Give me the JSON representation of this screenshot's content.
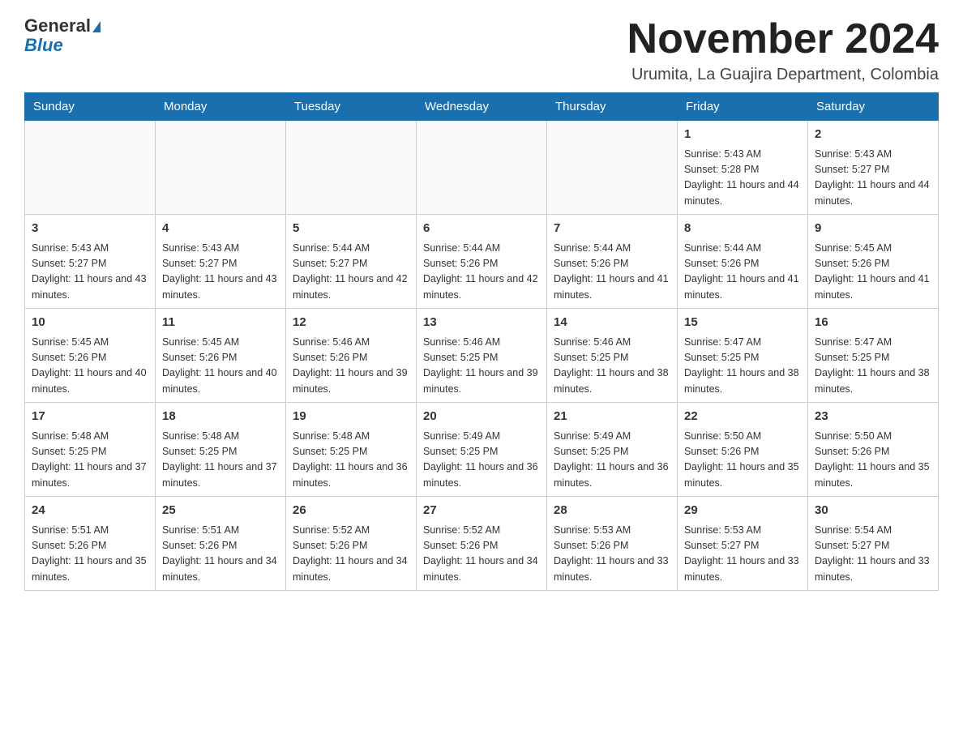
{
  "header": {
    "logo_line1": "General",
    "logo_line2": "Blue",
    "title": "November 2024",
    "subtitle": "Urumita, La Guajira Department, Colombia"
  },
  "days_of_week": [
    "Sunday",
    "Monday",
    "Tuesday",
    "Wednesday",
    "Thursday",
    "Friday",
    "Saturday"
  ],
  "weeks": [
    [
      {
        "day": "",
        "info": ""
      },
      {
        "day": "",
        "info": ""
      },
      {
        "day": "",
        "info": ""
      },
      {
        "day": "",
        "info": ""
      },
      {
        "day": "",
        "info": ""
      },
      {
        "day": "1",
        "info": "Sunrise: 5:43 AM\nSunset: 5:28 PM\nDaylight: 11 hours and 44 minutes."
      },
      {
        "day": "2",
        "info": "Sunrise: 5:43 AM\nSunset: 5:27 PM\nDaylight: 11 hours and 44 minutes."
      }
    ],
    [
      {
        "day": "3",
        "info": "Sunrise: 5:43 AM\nSunset: 5:27 PM\nDaylight: 11 hours and 43 minutes."
      },
      {
        "day": "4",
        "info": "Sunrise: 5:43 AM\nSunset: 5:27 PM\nDaylight: 11 hours and 43 minutes."
      },
      {
        "day": "5",
        "info": "Sunrise: 5:44 AM\nSunset: 5:27 PM\nDaylight: 11 hours and 42 minutes."
      },
      {
        "day": "6",
        "info": "Sunrise: 5:44 AM\nSunset: 5:26 PM\nDaylight: 11 hours and 42 minutes."
      },
      {
        "day": "7",
        "info": "Sunrise: 5:44 AM\nSunset: 5:26 PM\nDaylight: 11 hours and 41 minutes."
      },
      {
        "day": "8",
        "info": "Sunrise: 5:44 AM\nSunset: 5:26 PM\nDaylight: 11 hours and 41 minutes."
      },
      {
        "day": "9",
        "info": "Sunrise: 5:45 AM\nSunset: 5:26 PM\nDaylight: 11 hours and 41 minutes."
      }
    ],
    [
      {
        "day": "10",
        "info": "Sunrise: 5:45 AM\nSunset: 5:26 PM\nDaylight: 11 hours and 40 minutes."
      },
      {
        "day": "11",
        "info": "Sunrise: 5:45 AM\nSunset: 5:26 PM\nDaylight: 11 hours and 40 minutes."
      },
      {
        "day": "12",
        "info": "Sunrise: 5:46 AM\nSunset: 5:26 PM\nDaylight: 11 hours and 39 minutes."
      },
      {
        "day": "13",
        "info": "Sunrise: 5:46 AM\nSunset: 5:25 PM\nDaylight: 11 hours and 39 minutes."
      },
      {
        "day": "14",
        "info": "Sunrise: 5:46 AM\nSunset: 5:25 PM\nDaylight: 11 hours and 38 minutes."
      },
      {
        "day": "15",
        "info": "Sunrise: 5:47 AM\nSunset: 5:25 PM\nDaylight: 11 hours and 38 minutes."
      },
      {
        "day": "16",
        "info": "Sunrise: 5:47 AM\nSunset: 5:25 PM\nDaylight: 11 hours and 38 minutes."
      }
    ],
    [
      {
        "day": "17",
        "info": "Sunrise: 5:48 AM\nSunset: 5:25 PM\nDaylight: 11 hours and 37 minutes."
      },
      {
        "day": "18",
        "info": "Sunrise: 5:48 AM\nSunset: 5:25 PM\nDaylight: 11 hours and 37 minutes."
      },
      {
        "day": "19",
        "info": "Sunrise: 5:48 AM\nSunset: 5:25 PM\nDaylight: 11 hours and 36 minutes."
      },
      {
        "day": "20",
        "info": "Sunrise: 5:49 AM\nSunset: 5:25 PM\nDaylight: 11 hours and 36 minutes."
      },
      {
        "day": "21",
        "info": "Sunrise: 5:49 AM\nSunset: 5:25 PM\nDaylight: 11 hours and 36 minutes."
      },
      {
        "day": "22",
        "info": "Sunrise: 5:50 AM\nSunset: 5:26 PM\nDaylight: 11 hours and 35 minutes."
      },
      {
        "day": "23",
        "info": "Sunrise: 5:50 AM\nSunset: 5:26 PM\nDaylight: 11 hours and 35 minutes."
      }
    ],
    [
      {
        "day": "24",
        "info": "Sunrise: 5:51 AM\nSunset: 5:26 PM\nDaylight: 11 hours and 35 minutes."
      },
      {
        "day": "25",
        "info": "Sunrise: 5:51 AM\nSunset: 5:26 PM\nDaylight: 11 hours and 34 minutes."
      },
      {
        "day": "26",
        "info": "Sunrise: 5:52 AM\nSunset: 5:26 PM\nDaylight: 11 hours and 34 minutes."
      },
      {
        "day": "27",
        "info": "Sunrise: 5:52 AM\nSunset: 5:26 PM\nDaylight: 11 hours and 34 minutes."
      },
      {
        "day": "28",
        "info": "Sunrise: 5:53 AM\nSunset: 5:26 PM\nDaylight: 11 hours and 33 minutes."
      },
      {
        "day": "29",
        "info": "Sunrise: 5:53 AM\nSunset: 5:27 PM\nDaylight: 11 hours and 33 minutes."
      },
      {
        "day": "30",
        "info": "Sunrise: 5:54 AM\nSunset: 5:27 PM\nDaylight: 11 hours and 33 minutes."
      }
    ]
  ]
}
